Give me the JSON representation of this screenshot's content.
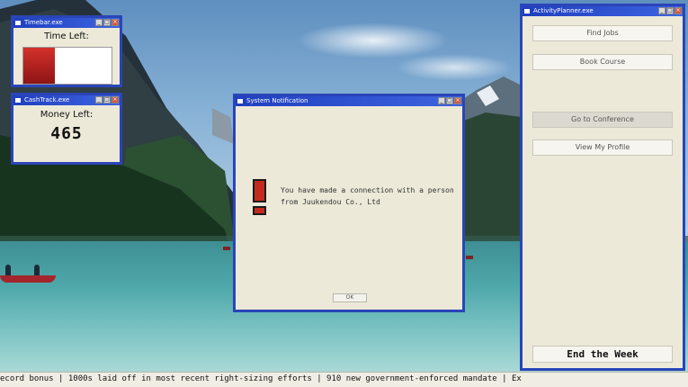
{
  "timebar": {
    "title": "Timebar.exe",
    "label": "Time Left:",
    "remaining_fraction": 0.36
  },
  "cashtrack": {
    "title": "CashTrack.exe",
    "label": "Money Left:",
    "value": "465"
  },
  "notification": {
    "title": "System Notification",
    "message": "You have made a connection with a person from Juukendou Co., Ltd",
    "ok_label": "OK"
  },
  "planner": {
    "title": "ActivityPlanner.exe",
    "buttons": [
      "Find Jobs",
      "Book Course",
      "Go to Conference",
      "View My Profile"
    ],
    "active_button": "Go to Conference",
    "end_label": "End the Week"
  },
  "ticker": {
    "text": "ecord bonus | 1000s laid off in most recent right-sizing efforts | 910 new government-enforced mandate | Ex"
  },
  "colors": {
    "title_bar": "#2a45b8",
    "time_fill": "#c0221e",
    "window_bg": "#ece9d8"
  },
  "icons": {
    "window": "window-icon",
    "notice": "exclamation-icon",
    "minimize": "minimize-icon",
    "maximize": "maximize-icon",
    "close": "close-icon"
  }
}
